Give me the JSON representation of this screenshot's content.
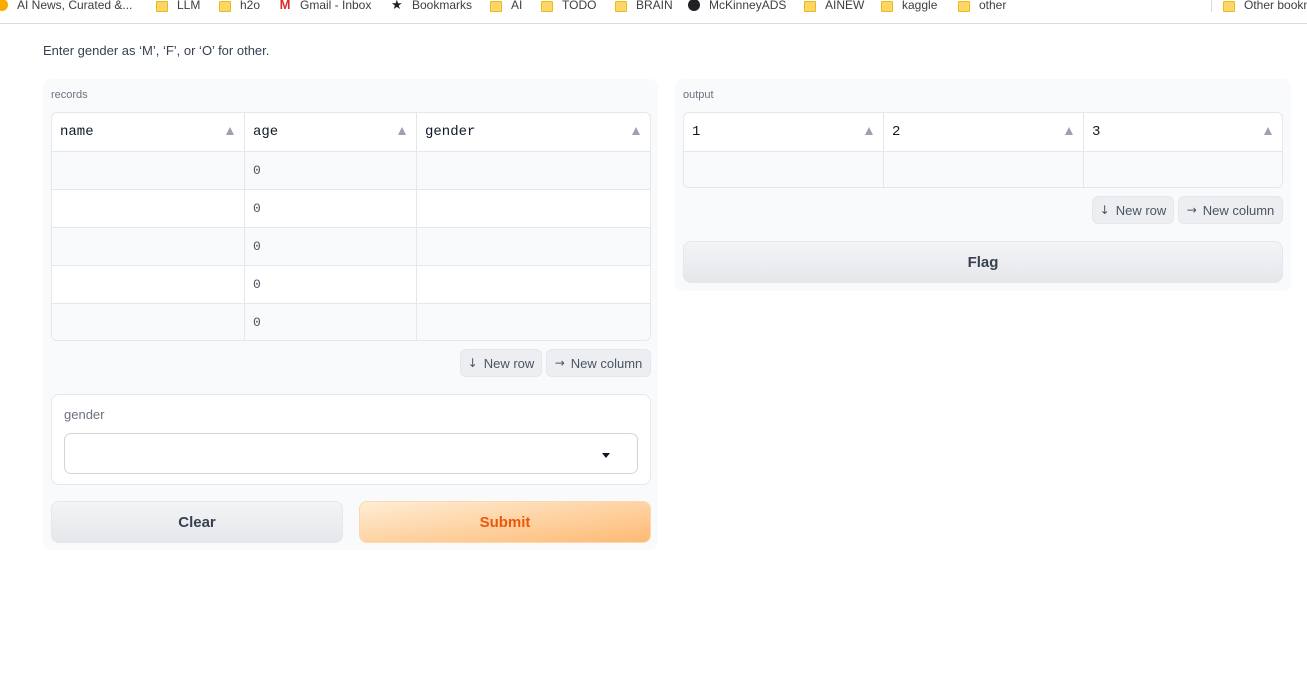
{
  "bookmarks": [
    {
      "label": "AI News, Curated &...",
      "icon": "sun-icon"
    },
    {
      "label": "LLM",
      "icon": "folder-icon"
    },
    {
      "label": "h2o",
      "icon": "folder-icon"
    },
    {
      "label": "Gmail - Inbox",
      "icon": "gmail-icon"
    },
    {
      "label": "Bookmarks",
      "icon": "star-icon"
    },
    {
      "label": "AI",
      "icon": "folder-icon"
    },
    {
      "label": "TODO",
      "icon": "folder-icon"
    },
    {
      "label": "BRAIN",
      "icon": "folder-icon"
    },
    {
      "label": "McKinneyADS",
      "icon": "globe-icon"
    },
    {
      "label": "AINEW",
      "icon": "folder-icon"
    },
    {
      "label": "kaggle",
      "icon": "folder-icon"
    },
    {
      "label": "other",
      "icon": "folder-icon"
    },
    {
      "label": "Other bookmarks",
      "icon": "folder-icon"
    }
  ],
  "description": "Enter gender as ‘M’, ‘F’, or ‘O’ for other.",
  "records": {
    "label": "records",
    "headers": [
      "name",
      "age",
      "gender"
    ],
    "rows": [
      [
        "",
        "0",
        ""
      ],
      [
        "",
        "0",
        ""
      ],
      [
        "",
        "0",
        ""
      ],
      [
        "",
        "0",
        ""
      ],
      [
        "",
        "0",
        ""
      ]
    ],
    "new_row_label": "New row",
    "new_column_label": "New column"
  },
  "gender_dropdown": {
    "label": "gender",
    "value": ""
  },
  "buttons": {
    "clear": "Clear",
    "submit": "Submit",
    "flag": "Flag"
  },
  "output": {
    "label": "output",
    "headers": [
      "1",
      "2",
      "3"
    ],
    "rows": [
      [
        "",
        "",
        ""
      ]
    ],
    "new_row_label": "New row",
    "new_column_label": "New column"
  },
  "colors": {
    "submit_text": "#ea580c",
    "submit_bg": "#fdba74",
    "panel_bg": "#f9fafb"
  }
}
